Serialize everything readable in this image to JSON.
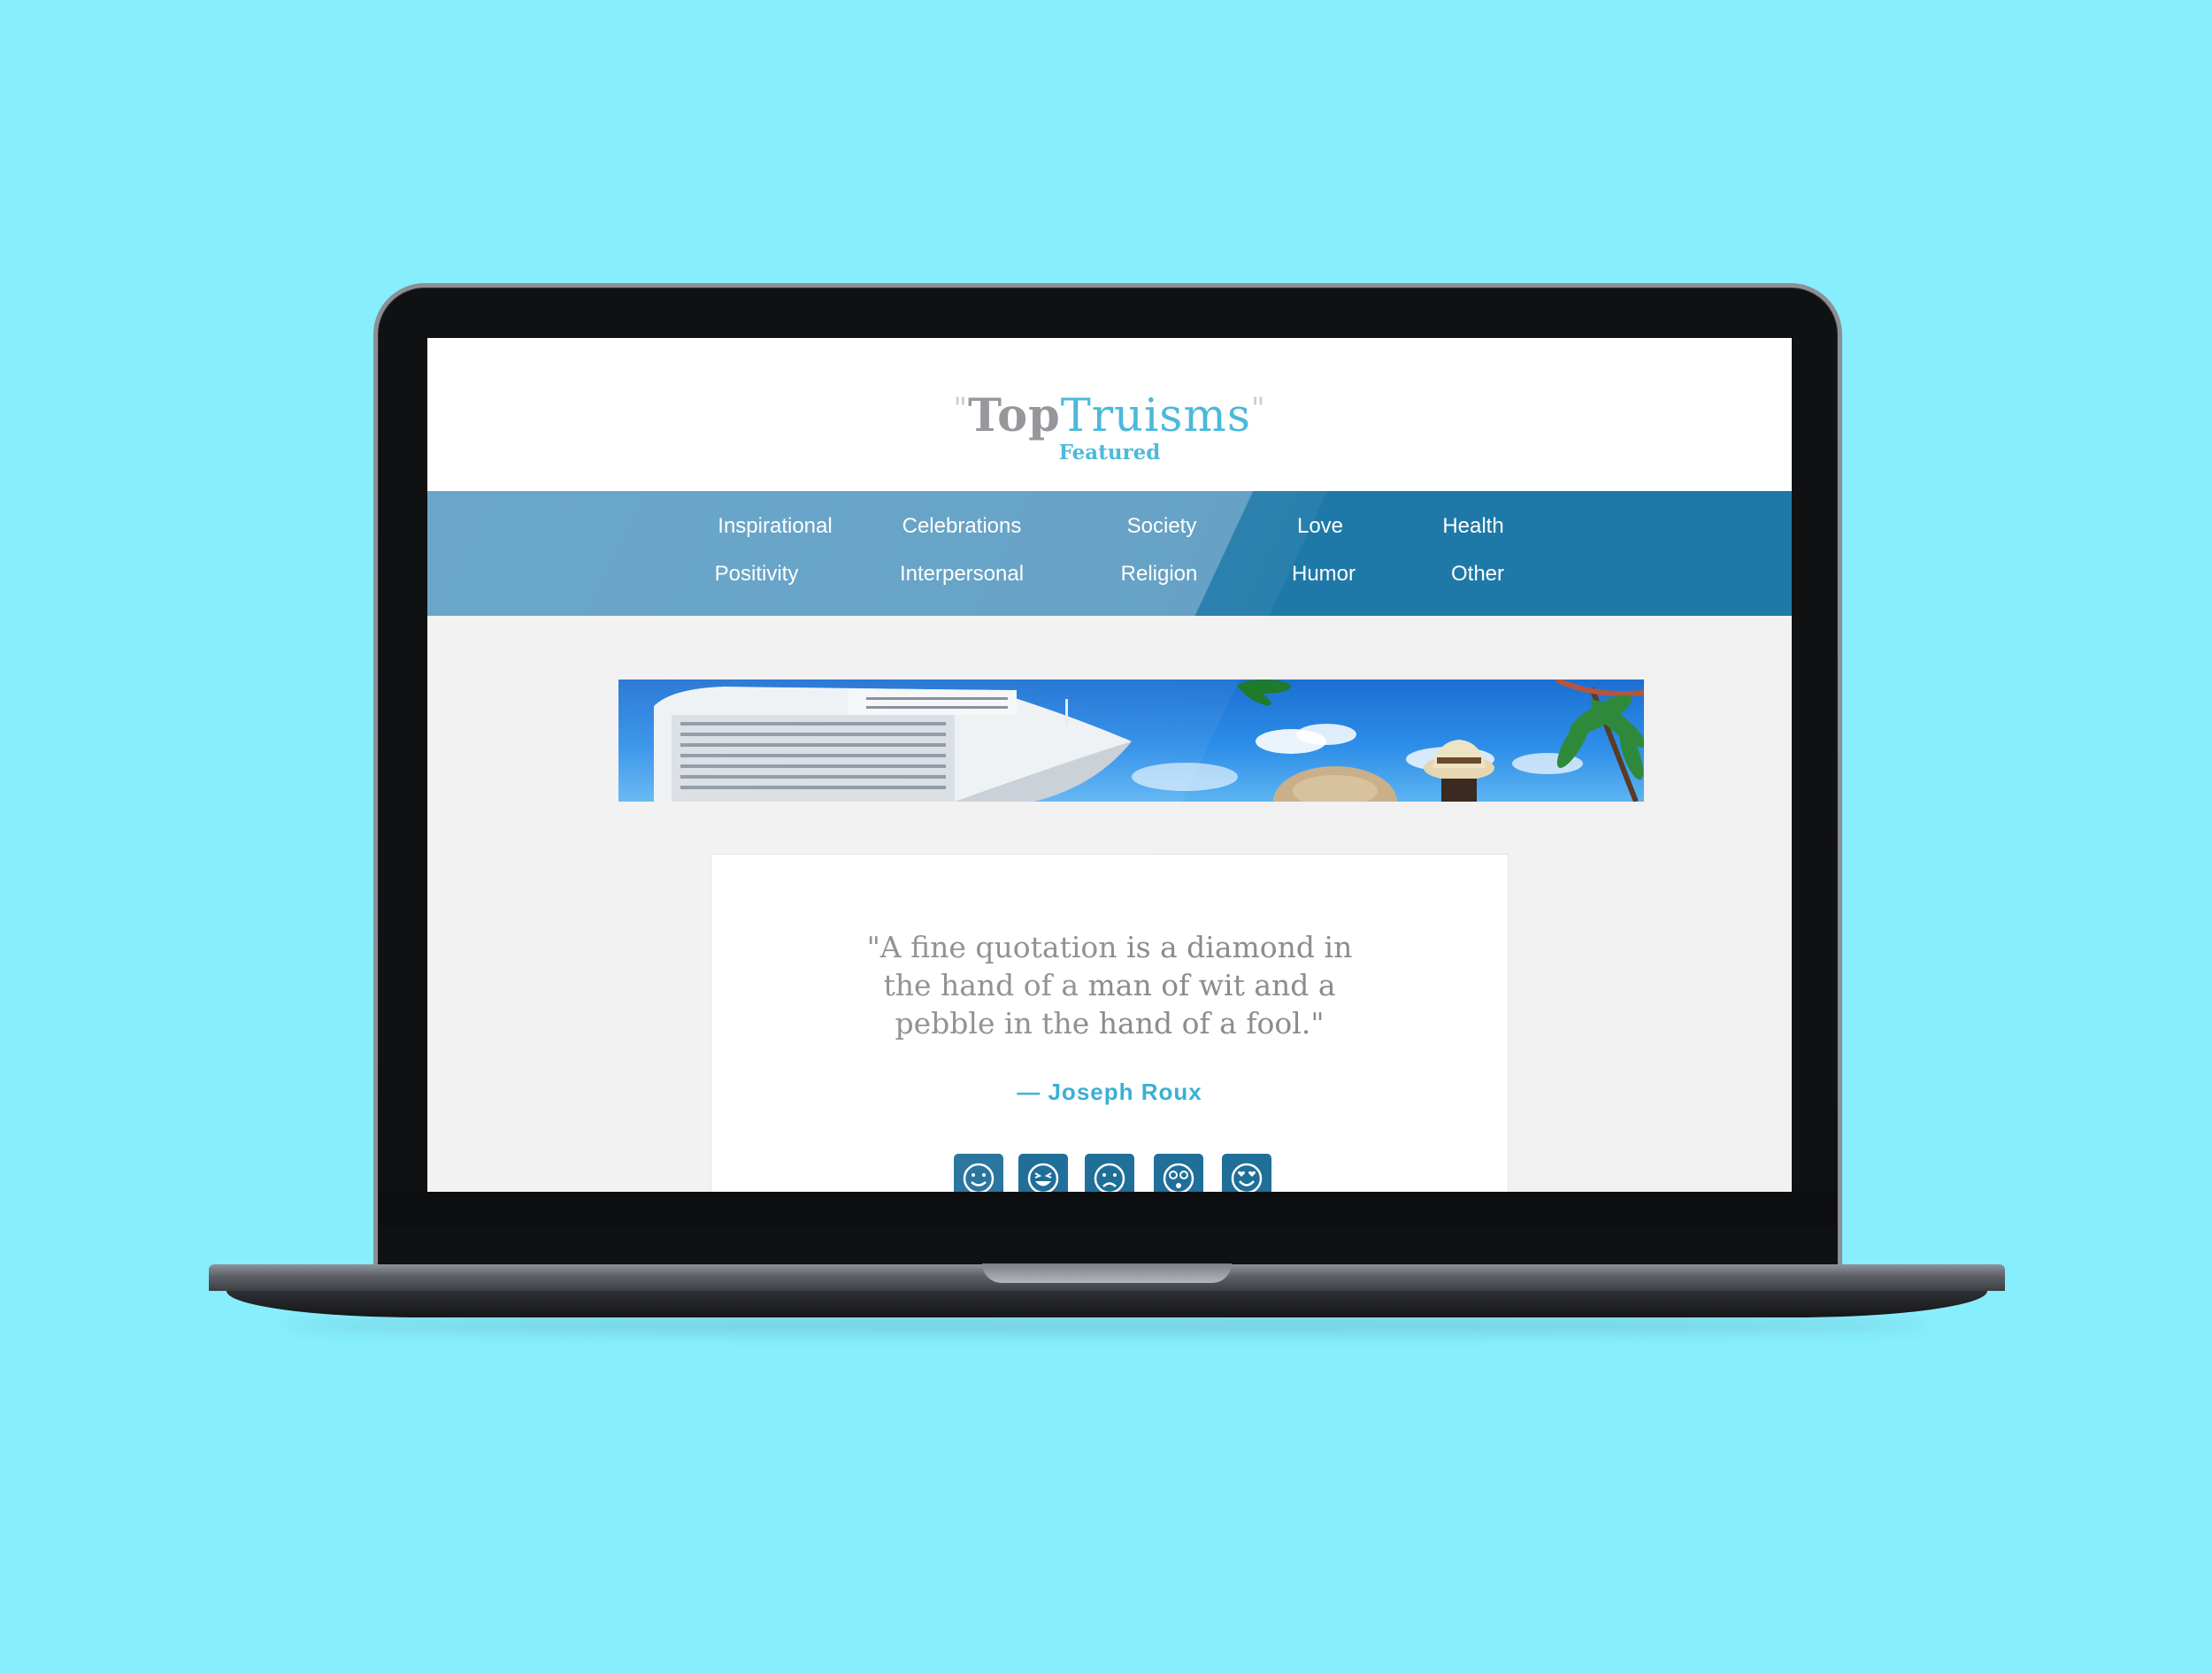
{
  "site": {
    "logo_open_quote": "\"",
    "logo_top": "Top",
    "logo_truisms": "Truisms",
    "logo_close_quote": "\"",
    "subtitle": "Featured"
  },
  "nav": {
    "row1": [
      "Inspirational",
      "Celebrations",
      "Society",
      "Love",
      "Health"
    ],
    "row2": [
      "Positivity",
      "Interpersonal",
      "Religion",
      "Humor",
      "Other"
    ]
  },
  "banner": {
    "icon": "cruise-ship-beach-image"
  },
  "featured_quote": {
    "text": "\"A fine quotation is a diamond in the hand of a man of wit and a pebble in the hand of a fool.\"",
    "author": "— Joseph Roux"
  },
  "reactions": [
    "smile-icon",
    "laugh-icon",
    "sad-icon",
    "shocked-icon",
    "love-icon"
  ],
  "colors": {
    "background": "#87eefd",
    "brand_blue": "#3fb5d8",
    "nav_light": "#5b9dc4",
    "nav_dark": "#1f79a8",
    "reaction_button": "#1f6f99"
  }
}
